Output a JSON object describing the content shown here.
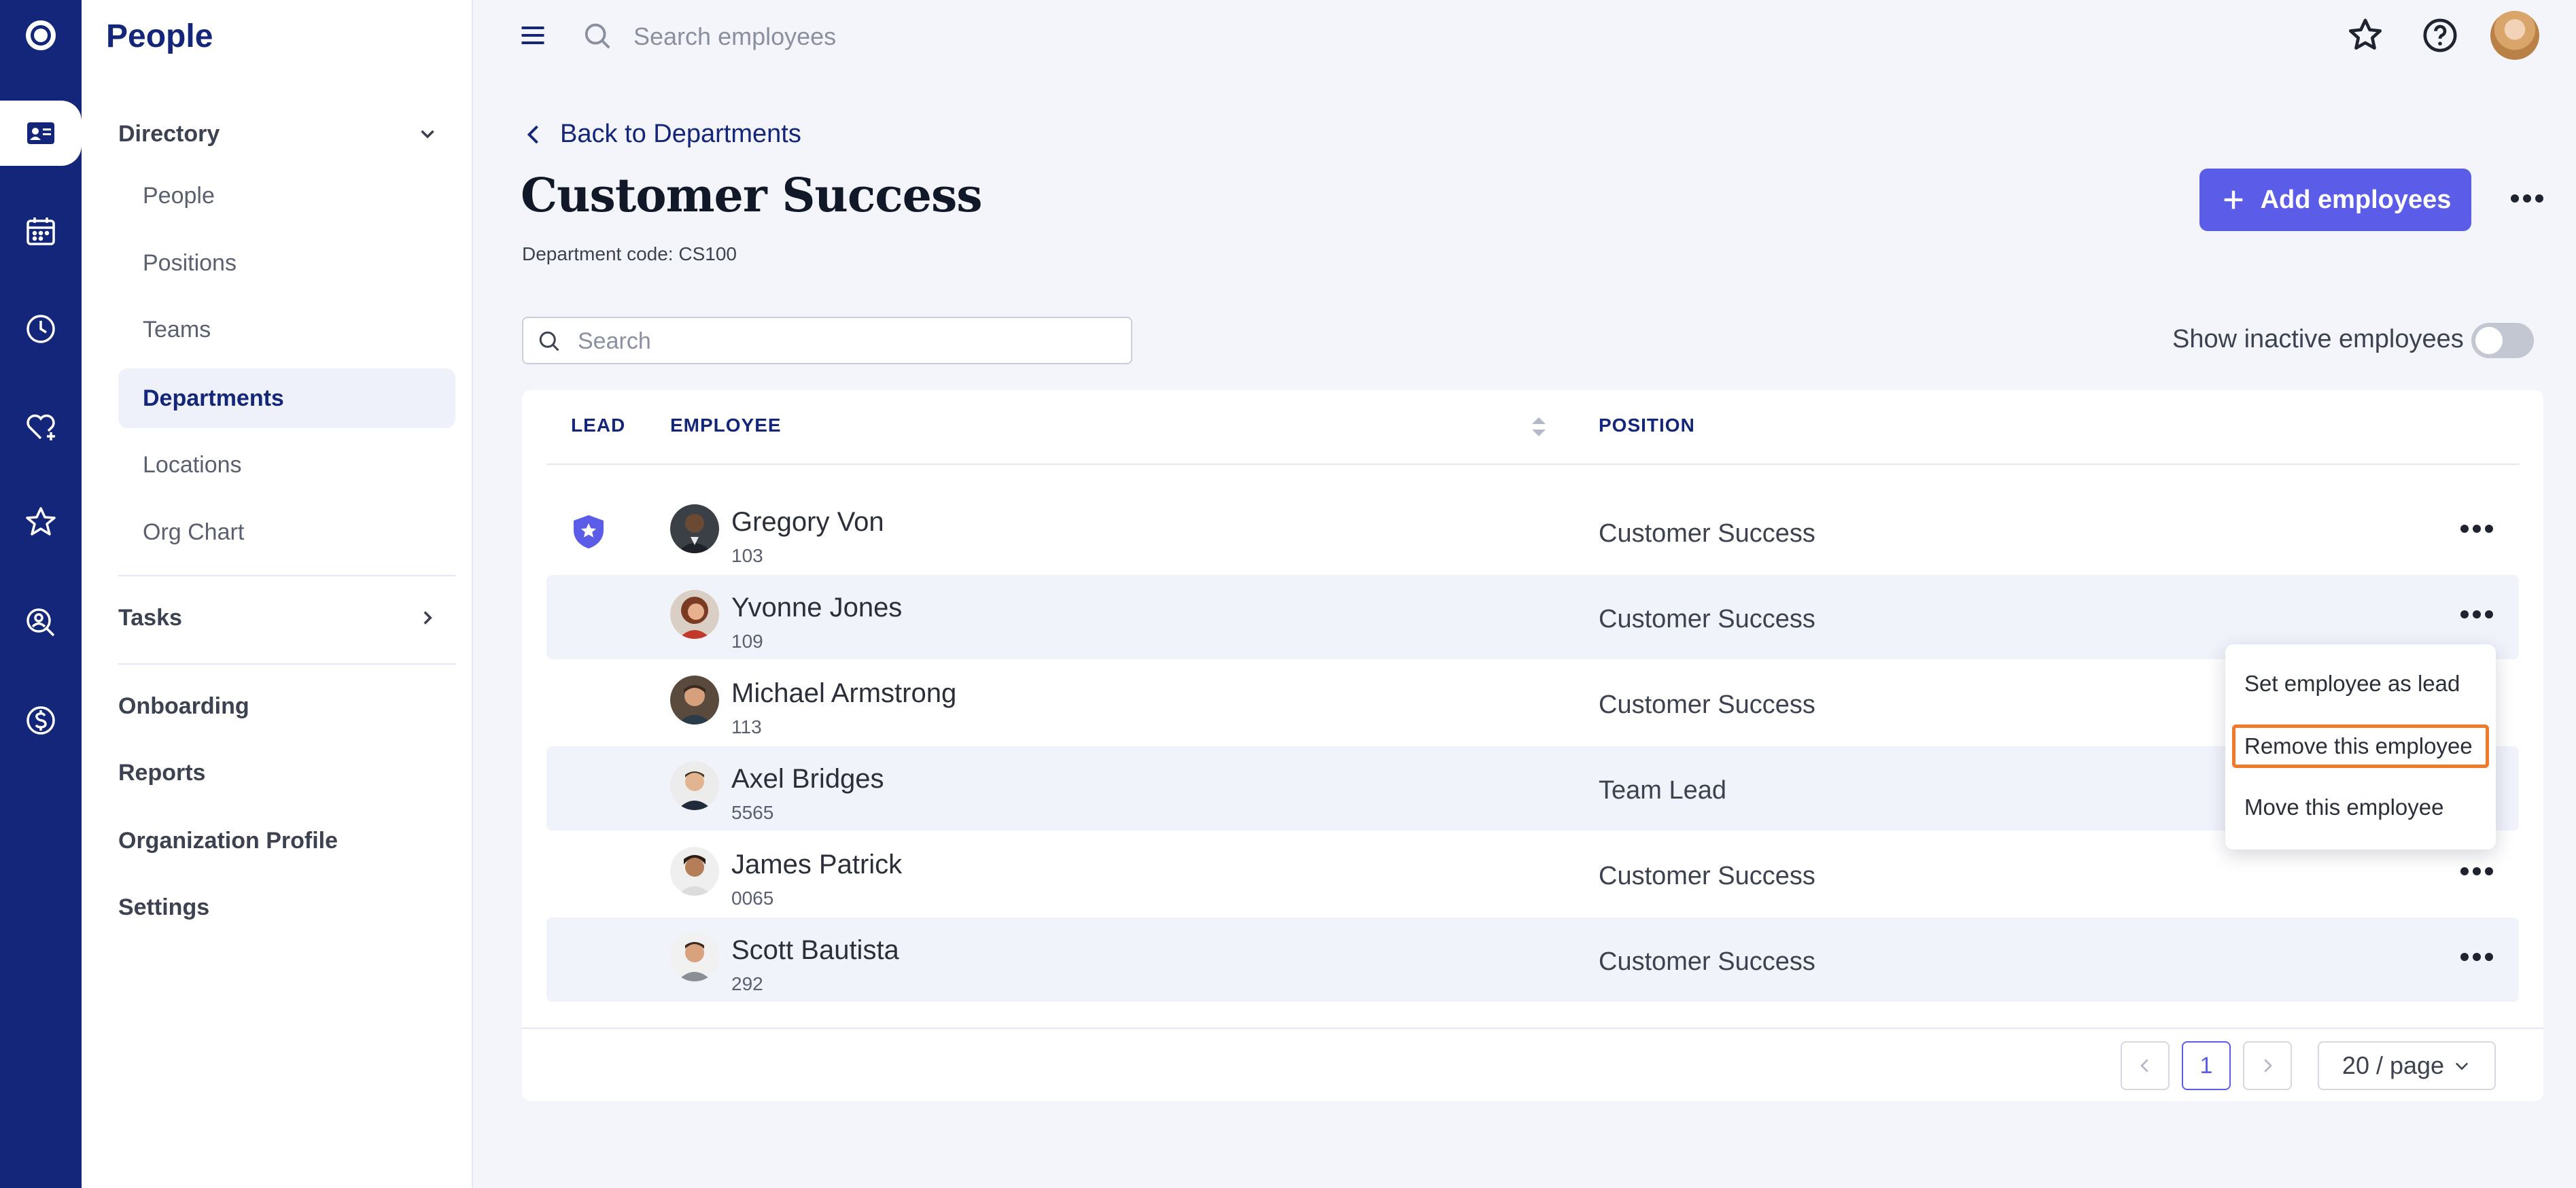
{
  "app": {
    "title": "People"
  },
  "rail": {
    "icons": [
      "app-logo-icon",
      "directory-icon",
      "calendar-icon",
      "clock-icon",
      "heart-plus-icon",
      "star-icon",
      "person-search-icon",
      "dollar-icon"
    ],
    "active": "directory-icon"
  },
  "sidebar": {
    "directory_label": "Directory",
    "directory_items": [
      "People",
      "Positions",
      "Teams",
      "Departments",
      "Locations",
      "Org Chart"
    ],
    "active_item": "Departments",
    "tasks_label": "Tasks",
    "main_items": [
      "Onboarding",
      "Reports",
      "Organization Profile",
      "Settings"
    ]
  },
  "topbar": {
    "search_placeholder": "Search employees"
  },
  "page": {
    "back_label": "Back to Departments",
    "title": "Customer Success",
    "department_code": "Department code: CS100",
    "add_button": "Add employees"
  },
  "filters": {
    "search_placeholder": "Search",
    "show_inactive_label": "Show inactive employees",
    "show_inactive_on": false
  },
  "table": {
    "columns": {
      "lead": "LEAD",
      "employee": "EMPLOYEE",
      "position": "POSITION"
    },
    "rows": [
      {
        "name": "Gregory Von",
        "id": "103",
        "position": "Customer Success",
        "is_lead": true
      },
      {
        "name": "Yvonne Jones",
        "id": "109",
        "position": "Customer Success",
        "is_lead": false
      },
      {
        "name": "Michael Armstrong",
        "id": "113",
        "position": "Customer Success",
        "is_lead": false
      },
      {
        "name": "Axel Bridges",
        "id": "5565",
        "position": "Team Lead",
        "is_lead": false
      },
      {
        "name": "James Patrick",
        "id": "0065",
        "position": "Customer Success",
        "is_lead": false
      },
      {
        "name": "Scott Bautista",
        "id": "292",
        "position": "Customer Success",
        "is_lead": false
      }
    ]
  },
  "context_menu": {
    "items": [
      "Set employee as lead",
      "Remove this employee",
      "Move this employee"
    ],
    "highlighted": "Remove this employee"
  },
  "pagination": {
    "current_page": "1",
    "page_size": "20 / page"
  },
  "colors": {
    "rail": "#14267a",
    "accent": "#5b5ce8",
    "highlight": "#f07a2a"
  }
}
